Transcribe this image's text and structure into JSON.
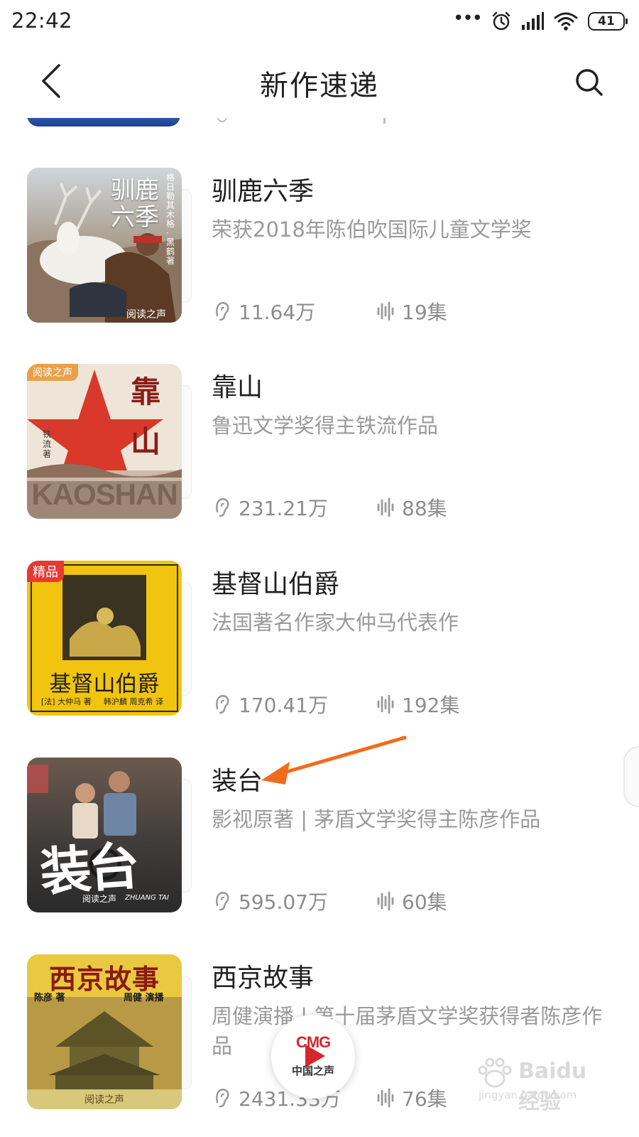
{
  "status_bar": {
    "time": "22:42",
    "dots": "•••",
    "battery": "41",
    "icons": [
      "alarm-icon",
      "signal-icon",
      "wifi-icon",
      "battery-icon"
    ]
  },
  "header": {
    "title": "新作速递",
    "back_icon": "chevron-left-icon",
    "search_icon": "search-icon"
  },
  "books": [
    {
      "title": "驯鹿六季",
      "desc": "荣获2018年陈伯吹国际儿童文学奖",
      "plays": "11.64万",
      "episodes": "19集",
      "cover": {
        "line1": "驯鹿",
        "line2": "六季",
        "author": "格日勒其木格·黑鹤 著",
        "brand": "阅读之声"
      }
    },
    {
      "title": "靠山",
      "desc": "鲁迅文学奖得主铁流作品",
      "plays": "231.21万",
      "episodes": "88集",
      "cover": {
        "badge": "阅读之声",
        "line1": "靠",
        "line2": "山",
        "author": "铁流 著",
        "latin": "KAOSHAN"
      }
    },
    {
      "title": "基督山伯爵",
      "desc": "法国著名作家大仲马代表作",
      "plays": "170.41万",
      "episodes": "192集",
      "cover": {
        "badge": "精品",
        "line1": "基督山伯爵",
        "author": "[法] 大仲马 著",
        "translator": "韩沪麟 周克希 译"
      }
    },
    {
      "title": "装台",
      "desc": "影视原著 | 茅盾文学奖得主陈彦作品",
      "plays": "595.07万",
      "episodes": "60集",
      "cover": {
        "line1": "装台",
        "brand": "阅读之声",
        "latin": "ZHUANG TAI"
      }
    },
    {
      "title": "西京故事",
      "desc": "周健演播 | 第十届茅盾文学奖获得者陈彦作品",
      "plays": "2431.33万",
      "episodes": "76集",
      "cover": {
        "line1": "西京故事",
        "author": "陈彦 著",
        "narrator": "周健 演播",
        "brand": "阅读之声"
      }
    }
  ],
  "player": {
    "logo": "CMG",
    "name": "中国之声"
  },
  "watermark": {
    "text": "Baidu 经验",
    "url": "jingyan.baidu.com"
  },
  "colors": {
    "accent": "#f26b1d",
    "cmg_red": "#d7262c",
    "gray_text": "#9a9a9a"
  }
}
